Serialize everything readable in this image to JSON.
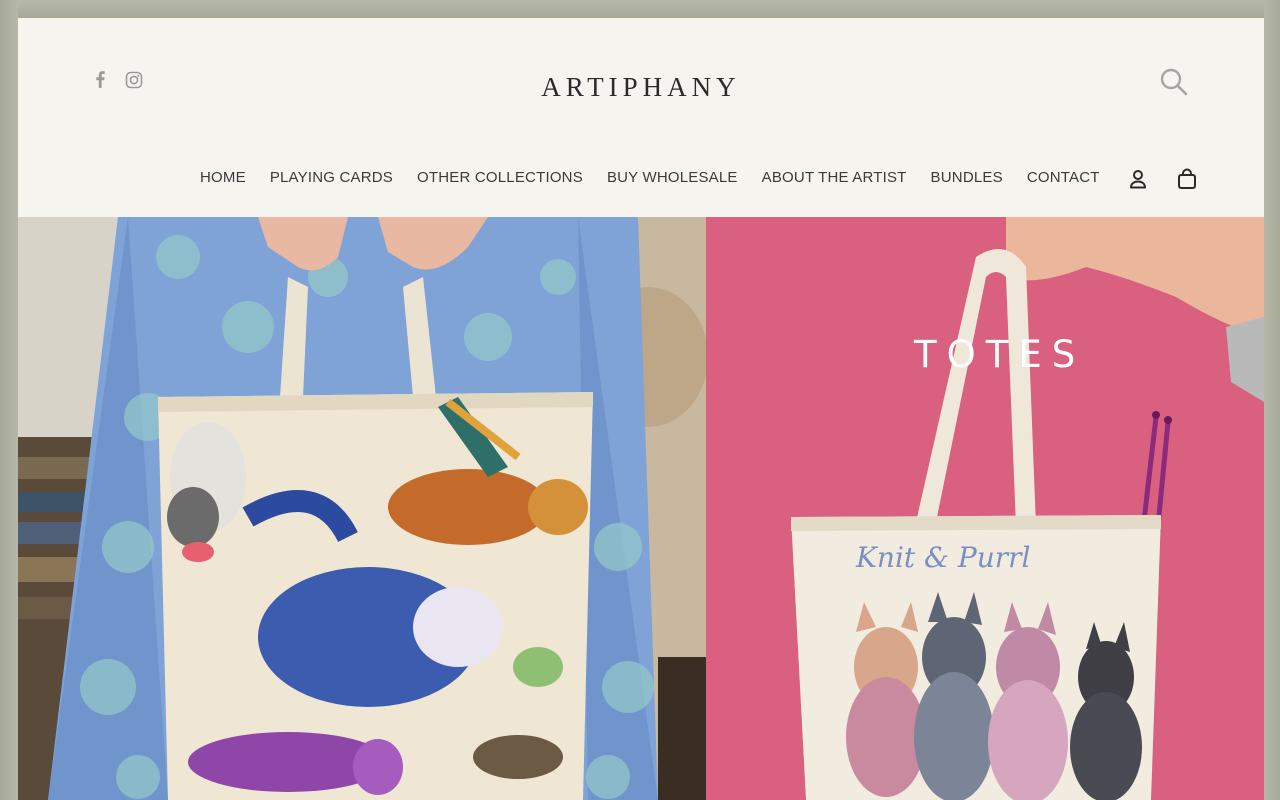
{
  "brand": {
    "name": "ARTIPHANY"
  },
  "social": [
    {
      "icon": "facebook-icon",
      "label": "Facebook"
    },
    {
      "icon": "instagram-icon",
      "label": "Instagram"
    }
  ],
  "nav": {
    "items": [
      {
        "label": "HOME"
      },
      {
        "label": "PLAYING CARDS"
      },
      {
        "label": "OTHER COLLECTIONS"
      },
      {
        "label": "BUY WHOLESALE"
      },
      {
        "label": "ABOUT THE ARTIST"
      },
      {
        "label": "BUNDLES"
      },
      {
        "label": "CONTACT"
      }
    ],
    "icons": [
      "account-icon",
      "cart-icon"
    ]
  },
  "hero": {
    "right_title": "TOTES",
    "bag_text": "Knit & Purrl"
  },
  "colors": {
    "header_bg": "#f5f4ef",
    "hero_pink": "#d9607e",
    "text_dark": "#2b2b2b"
  }
}
